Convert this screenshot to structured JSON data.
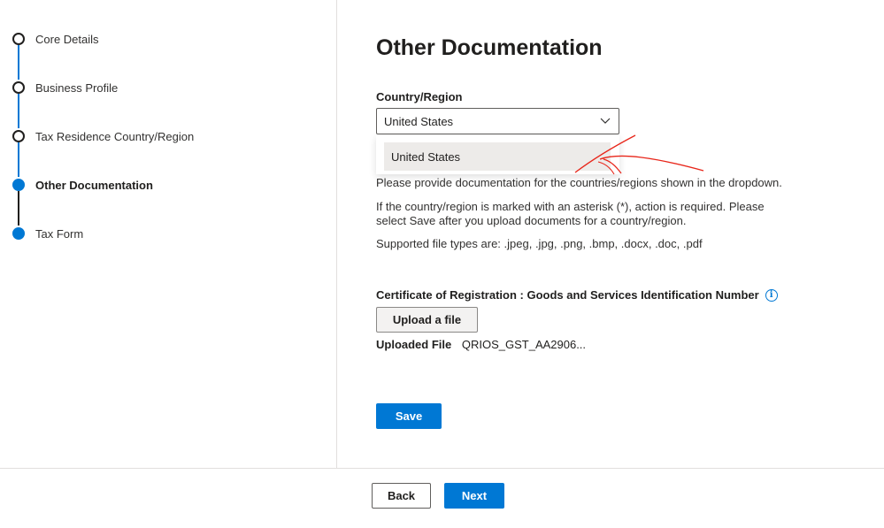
{
  "stepper": {
    "steps": [
      {
        "label": "Core Details",
        "state": "completed"
      },
      {
        "label": "Business Profile",
        "state": "completed"
      },
      {
        "label": "Tax Residence Country/Region",
        "state": "completed"
      },
      {
        "label": "Other Documentation",
        "state": "current"
      },
      {
        "label": "Tax Form",
        "state": "upcoming"
      }
    ]
  },
  "main": {
    "title": "Other Documentation",
    "country_label": "Country/Region",
    "country_selected": "United States",
    "dropdown_options": [
      "United States"
    ],
    "instructions": {
      "p1": "Please provide documentation for the countries/regions shown in the dropdown.",
      "p2_line1": "If the country/region is marked with an asterisk (*), action is required.  Please",
      "p2_line2": "select Save after you upload documents for a country/region.",
      "p3": "Supported file types are: .jpeg, .jpg, .png, .bmp, .docx, .doc, .pdf"
    },
    "certificate_label": "Certificate of Registration : Goods and Services Identification Number",
    "info_icon_glyph": "i",
    "upload_button": "Upload a file",
    "uploaded_file_label": "Uploaded File",
    "uploaded_file_name": "QRIOS_GST_AA2906...",
    "save_button": "Save"
  },
  "footer": {
    "back_button": "Back",
    "next_button": "Next"
  },
  "colors": {
    "accent": "#0078d4",
    "annotation": "#e8261a"
  }
}
